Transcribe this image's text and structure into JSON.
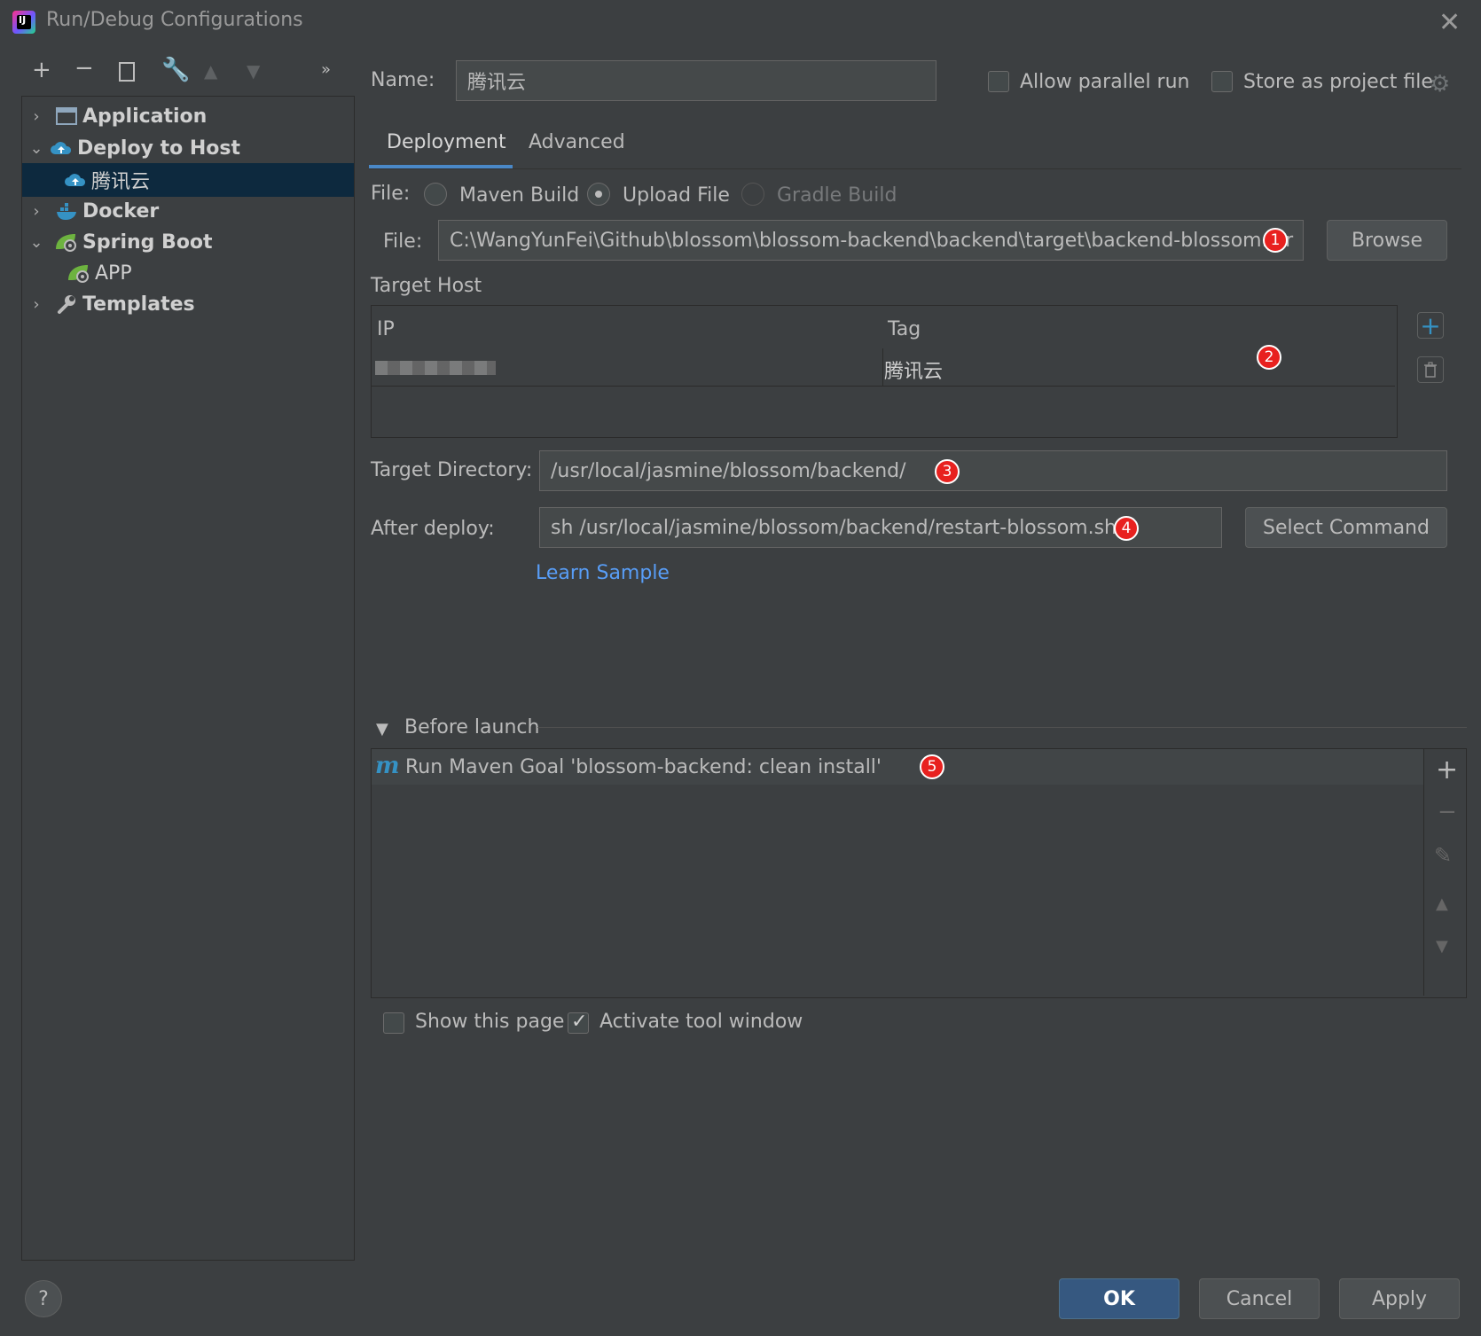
{
  "window": {
    "title": "Run/Debug Configurations",
    "logo_text": "IJ"
  },
  "tree": [
    {
      "label": "Application",
      "expanded": false,
      "icon": "application-icon",
      "bold": true
    },
    {
      "label": "Deploy to Host",
      "expanded": true,
      "icon": "cloud-upload-icon",
      "bold": true
    },
    {
      "label": "腾讯云",
      "icon": "cloud-upload-icon",
      "selected": true
    },
    {
      "label": "Docker",
      "expanded": false,
      "icon": "docker-icon",
      "bold": true
    },
    {
      "label": "Spring Boot",
      "expanded": true,
      "icon": "spring-boot-icon",
      "bold": true
    },
    {
      "label": "APP",
      "icon": "spring-boot-icon"
    },
    {
      "label": "Templates",
      "expanded": false,
      "icon": "wrench-icon",
      "bold": true
    }
  ],
  "form": {
    "name_label": "Name:",
    "name_value": "腾讯云",
    "allow_parallel_label": "Allow parallel run",
    "store_project_label": "Store as project file",
    "tabs": [
      "Deployment",
      "Advanced"
    ],
    "file_label": "File:",
    "radio_options": [
      "Maven Build",
      "Upload File",
      "Gradle Build"
    ],
    "file_path_label": "File:",
    "file_path_value": "C:\\WangYunFei\\Github\\blossom\\blossom-backend\\backend\\target\\backend-blossom.jar",
    "browse_label": "Browse",
    "target_host_label": "Target Host",
    "table_headers": [
      "IP",
      "Tag"
    ],
    "table_rows": [
      {
        "ip": "",
        "tag": "腾讯云"
      }
    ],
    "target_dir_label": "Target Directory:",
    "target_dir_value": "/usr/local/jasmine/blossom/backend/",
    "after_deploy_label": "After deploy:",
    "after_deploy_value": "sh /usr/local/jasmine/blossom/backend/restart-blossom.sh",
    "select_command_label": "Select Command",
    "learn_sample_label": "Learn Sample",
    "before_launch_label": "Before launch",
    "before_launch_items": [
      "Run Maven Goal 'blossom-backend: clean install'"
    ],
    "show_page_label": "Show this page",
    "activate_tool_label": "Activate tool window"
  },
  "badges": [
    "1",
    "2",
    "3",
    "4",
    "5"
  ],
  "buttons": {
    "ok": "OK",
    "cancel": "Cancel",
    "apply": "Apply",
    "help": "?"
  },
  "colors": {
    "accent": "#4a88c7",
    "badge": "#e8211f",
    "selected": "#0d293e",
    "primary_button": "#365880"
  }
}
